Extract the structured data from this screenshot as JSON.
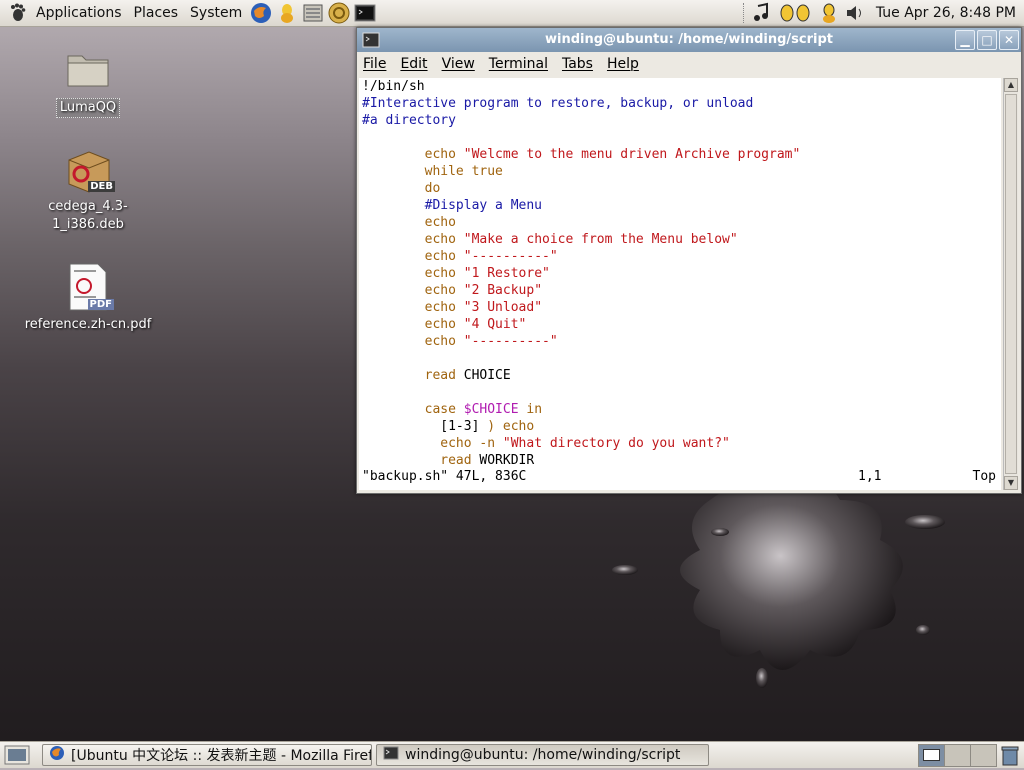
{
  "top_panel": {
    "menus": [
      "Applications",
      "Places",
      "System"
    ],
    "launchers": [
      "firefox-icon",
      "qq-icon",
      "file-manager-icon",
      "help-icon",
      "terminal-icon"
    ],
    "clock": "Tue Apr 26,  8:48 PM"
  },
  "desktop": {
    "icons": [
      {
        "label": "LumaQQ",
        "icon": "folder-icon"
      },
      {
        "label": "cedega_4.3-1_i386.deb",
        "icon": "deb-package-icon",
        "badge": "DEB"
      },
      {
        "label": "reference.zh-cn.pdf",
        "icon": "pdf-file-icon",
        "badge": "PDF"
      }
    ]
  },
  "window": {
    "title": "winding@ubuntu: /home/winding/script",
    "menus": [
      "File",
      "Edit",
      "View",
      "Terminal",
      "Tabs",
      "Help"
    ],
    "code_lines": [
      [
        {
          "t": "!/bin/sh",
          "c": "norm"
        }
      ],
      [
        {
          "t": "#Interactive program to restore, backup, or unload",
          "c": "cmt"
        }
      ],
      [
        {
          "t": "#a directory",
          "c": "cmt"
        }
      ],
      [
        {
          "t": "",
          "c": "norm"
        }
      ],
      [
        {
          "t": "        echo ",
          "c": "kw"
        },
        {
          "t": "\"Welcme to the menu driven Archive program\"",
          "c": "str"
        }
      ],
      [
        {
          "t": "        while true",
          "c": "kw"
        }
      ],
      [
        {
          "t": "        do",
          "c": "kw"
        }
      ],
      [
        {
          "t": "        #Display a Menu",
          "c": "cmt"
        }
      ],
      [
        {
          "t": "        echo",
          "c": "kw"
        }
      ],
      [
        {
          "t": "        echo ",
          "c": "kw"
        },
        {
          "t": "\"Make a choice from the Menu below\"",
          "c": "str"
        }
      ],
      [
        {
          "t": "        echo ",
          "c": "kw"
        },
        {
          "t": "\"----------\"",
          "c": "str"
        }
      ],
      [
        {
          "t": "        echo ",
          "c": "kw"
        },
        {
          "t": "\"1 Restore\"",
          "c": "str"
        }
      ],
      [
        {
          "t": "        echo ",
          "c": "kw"
        },
        {
          "t": "\"2 Backup\"",
          "c": "str"
        }
      ],
      [
        {
          "t": "        echo ",
          "c": "kw"
        },
        {
          "t": "\"3 Unload\"",
          "c": "str"
        }
      ],
      [
        {
          "t": "        echo ",
          "c": "kw"
        },
        {
          "t": "\"4 Quit\"",
          "c": "str"
        }
      ],
      [
        {
          "t": "        echo ",
          "c": "kw"
        },
        {
          "t": "\"----------\"",
          "c": "str"
        }
      ],
      [
        {
          "t": "",
          "c": "norm"
        }
      ],
      [
        {
          "t": "        read ",
          "c": "kw"
        },
        {
          "t": "CHOICE",
          "c": "norm"
        }
      ],
      [
        {
          "t": "",
          "c": "norm"
        }
      ],
      [
        {
          "t": "        case ",
          "c": "kw"
        },
        {
          "t": "$CHOICE",
          "c": "var"
        },
        {
          "t": " in",
          "c": "kw"
        }
      ],
      [
        {
          "t": "          [1-3] ",
          "c": "norm"
        },
        {
          "t": ") echo",
          "c": "kw"
        }
      ],
      [
        {
          "t": "          echo -n ",
          "c": "kw"
        },
        {
          "t": "\"What directory do you want?\"",
          "c": "str"
        }
      ],
      [
        {
          "t": "          read ",
          "c": "kw"
        },
        {
          "t": "WORKDIR",
          "c": "norm"
        }
      ]
    ],
    "status": {
      "file": "\"backup.sh\" 47L, 836C",
      "position": "1,1",
      "scroll": "Top"
    }
  },
  "taskbar": {
    "tasks": [
      {
        "label": "[Ubuntu 中文论坛 :: 发表新主题 - Mozilla Firefox]",
        "icon": "firefox-icon"
      },
      {
        "label": "winding@ubuntu: /home/winding/script",
        "icon": "terminal-icon"
      }
    ]
  }
}
